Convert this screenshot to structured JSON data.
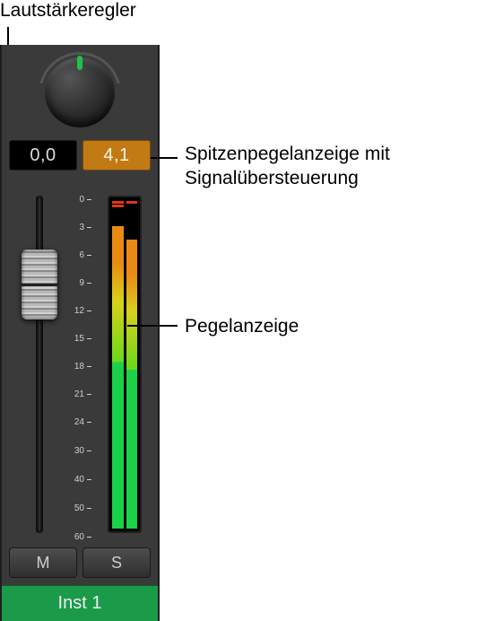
{
  "labels": {
    "volume_knob": "Lautstärkeregler",
    "peak_display": "Spitzenpegelanzeige mit Signalübersteuerung",
    "level_meter": "Pegelanzeige"
  },
  "channel": {
    "gain_db": "0,0",
    "peak_db": "4,1",
    "scale_ticks": [
      "0",
      "3",
      "6",
      "9",
      "12",
      "15",
      "18",
      "21",
      "24",
      "30",
      "40",
      "50",
      "60"
    ],
    "mute_label": "M",
    "solo_label": "S",
    "track_name": "Inst 1"
  }
}
